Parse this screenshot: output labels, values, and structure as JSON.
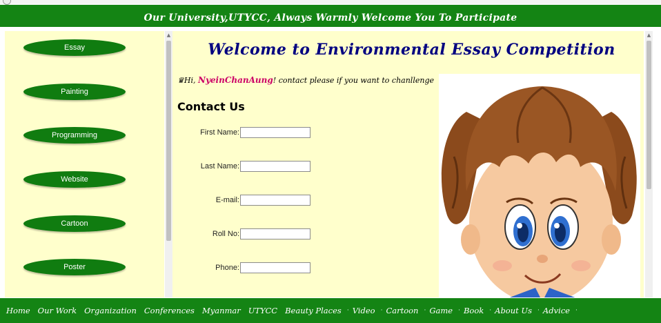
{
  "header": {
    "banner": "Our University,UTYCC, Always Warmly Welcome You To Participate"
  },
  "sidebar": {
    "items": [
      {
        "label": "Essay"
      },
      {
        "label": "Painting"
      },
      {
        "label": "Programming"
      },
      {
        "label": "Website"
      },
      {
        "label": "Cartoon"
      },
      {
        "label": "Poster"
      }
    ]
  },
  "main": {
    "title": "Welcome to Environmental Essay Competition",
    "greeting_prefix": "Hi, ",
    "user_name": "NyeinChanAung",
    "greeting_suffix": "! contact please if you want to chanllenge",
    "contact_title": "Contact Us",
    "fields": [
      {
        "label": "First Name:",
        "value": ""
      },
      {
        "label": "Last Name:",
        "value": ""
      },
      {
        "label": "E-mail:",
        "value": ""
      },
      {
        "label": "Roll No:",
        "value": ""
      },
      {
        "label": "Phone:",
        "value": ""
      }
    ],
    "image_alt": "cartoon girl with pigtails"
  },
  "footer": {
    "links": [
      {
        "label": "Home"
      },
      {
        "label": "Our Work"
      },
      {
        "label": "Organization"
      },
      {
        "label": "Conferences"
      },
      {
        "label": "Myanmar"
      },
      {
        "label": "UTYCC"
      },
      {
        "label": "Beauty Places"
      },
      {
        "label": "Video"
      },
      {
        "label": "Cartoon"
      },
      {
        "label": "Game"
      },
      {
        "label": "Book"
      },
      {
        "label": "About Us"
      },
      {
        "label": "Advice"
      }
    ]
  },
  "colors": {
    "brand_green": "#148414",
    "panel_bg": "#ffffcc",
    "title_navy": "#000080",
    "name_pink": "#cc0066"
  }
}
